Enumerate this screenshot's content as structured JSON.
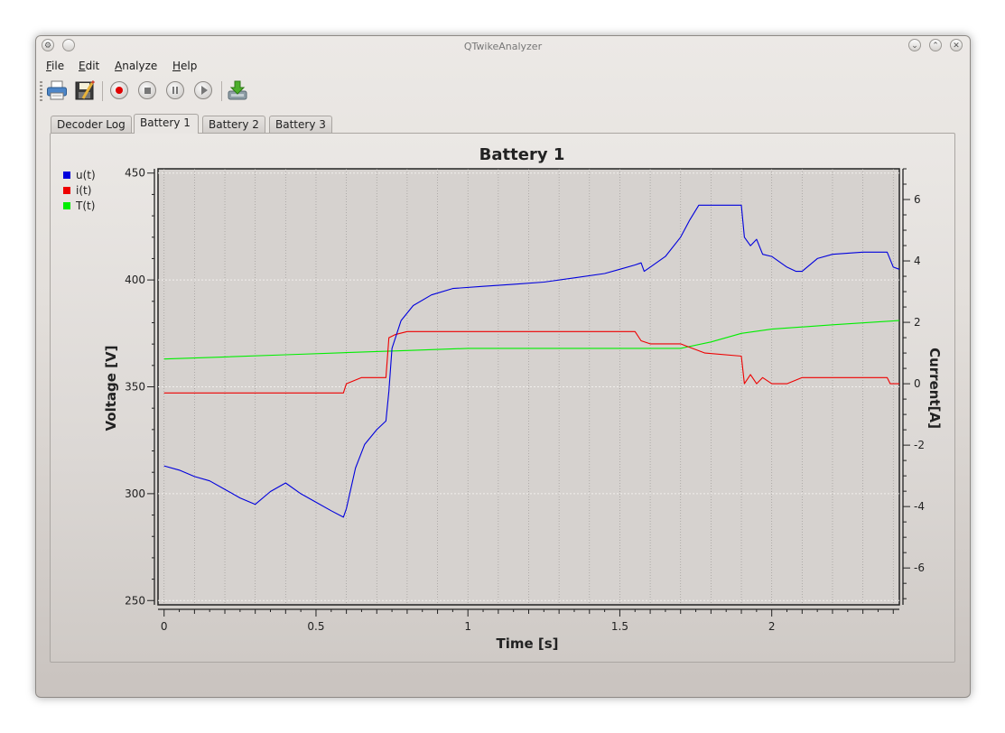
{
  "window": {
    "title": "QTwikeAnalyzer"
  },
  "menu": [
    "File",
    "Edit",
    "Analyze",
    "Help"
  ],
  "toolbar": [
    "print-icon",
    "save-icon",
    "record-icon",
    "stop-icon",
    "pause-icon",
    "play-icon",
    "download-icon"
  ],
  "tabs": [
    "Decoder Log",
    "Battery 1",
    "Battery 2",
    "Battery 3"
  ],
  "active_tab": "Battery 1",
  "chart_data": {
    "type": "line",
    "title": "Battery 1",
    "xlabel": "Time [s]",
    "ylabel": "Voltage [V]",
    "y2label": "Current[A]",
    "xlim": [
      -0.02,
      2.42
    ],
    "ylim": [
      248,
      452
    ],
    "y2lim": [
      -7.2,
      7.0
    ],
    "xticks": [
      0,
      0.5,
      1,
      1.5,
      2
    ],
    "xtick_labels": [
      "0",
      "0.5",
      "1",
      "1.5",
      "2"
    ],
    "yticks": [
      250,
      300,
      350,
      400,
      450
    ],
    "ytick_labels": [
      "250",
      "300",
      "350",
      "400",
      "450"
    ],
    "y2ticks": [
      -6,
      -4,
      -2,
      0,
      2,
      4,
      6
    ],
    "y2tick_labels": [
      "-6",
      "-4",
      "-2",
      "0",
      "2",
      "4",
      "6"
    ],
    "grid": true,
    "legend_position": "top-left",
    "series": [
      {
        "name": "u(t)",
        "color": "#0000dd",
        "axis": "left",
        "x": [
          0,
          0.05,
          0.1,
          0.15,
          0.2,
          0.25,
          0.3,
          0.35,
          0.4,
          0.45,
          0.5,
          0.55,
          0.59,
          0.6,
          0.63,
          0.66,
          0.7,
          0.73,
          0.74,
          0.75,
          0.78,
          0.82,
          0.88,
          0.95,
          1.05,
          1.15,
          1.25,
          1.35,
          1.45,
          1.5,
          1.55,
          1.57,
          1.58,
          1.6,
          1.65,
          1.7,
          1.73,
          1.76,
          1.8,
          1.9,
          1.91,
          1.93,
          1.95,
          1.97,
          2.0,
          2.05,
          2.08,
          2.1,
          2.15,
          2.2,
          2.3,
          2.38,
          2.4,
          2.42
        ],
        "y": [
          313,
          311,
          308,
          306,
          302,
          298,
          295,
          301,
          305,
          300,
          296,
          292,
          289,
          293,
          312,
          323,
          330,
          334,
          348,
          368,
          381,
          388,
          393,
          396,
          397,
          398,
          399,
          401,
          403,
          405,
          407,
          408,
          404,
          406,
          411,
          420,
          428,
          435,
          435,
          435,
          420,
          416,
          419,
          412,
          411,
          406,
          404,
          404,
          410,
          412,
          413,
          413,
          406,
          405
        ]
      },
      {
        "name": "i(t)",
        "color": "#ee0000",
        "axis": "right",
        "x": [
          0,
          0.1,
          0.2,
          0.3,
          0.4,
          0.5,
          0.59,
          0.6,
          0.65,
          0.73,
          0.74,
          0.76,
          0.8,
          0.9,
          1.0,
          1.1,
          1.2,
          1.3,
          1.4,
          1.5,
          1.55,
          1.57,
          1.6,
          1.7,
          1.78,
          1.9,
          1.91,
          1.93,
          1.95,
          1.97,
          2.0,
          2.05,
          2.1,
          2.2,
          2.3,
          2.38,
          2.39,
          2.42
        ],
        "y": [
          -0.3,
          -0.3,
          -0.3,
          -0.3,
          -0.3,
          -0.3,
          -0.3,
          0.0,
          0.2,
          0.2,
          1.5,
          1.6,
          1.7,
          1.7,
          1.7,
          1.7,
          1.7,
          1.7,
          1.7,
          1.7,
          1.7,
          1.4,
          1.3,
          1.3,
          1.0,
          0.9,
          0.0,
          0.3,
          0.0,
          0.2,
          0.0,
          0.0,
          0.2,
          0.2,
          0.2,
          0.2,
          0.0,
          0.0
        ]
      },
      {
        "name": "T(t)",
        "color": "#00ee00",
        "axis": "left",
        "x": [
          0,
          0.2,
          0.4,
          0.6,
          0.8,
          1.0,
          1.2,
          1.4,
          1.6,
          1.7,
          1.8,
          1.9,
          2.0,
          2.2,
          2.42
        ],
        "y": [
          363,
          364,
          365,
          366,
          367,
          368,
          368,
          368,
          368,
          368,
          371,
          375,
          377,
          379,
          381
        ]
      }
    ]
  }
}
